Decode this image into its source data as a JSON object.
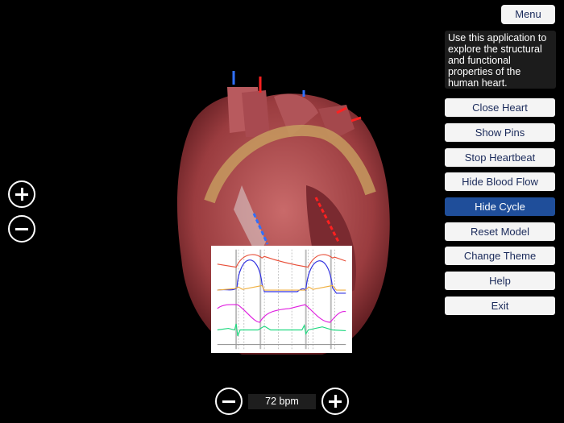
{
  "menu_label": "Menu",
  "info_text": "Use this application to explore the structural and functional properties of the human heart.",
  "buttons": [
    "Close Heart",
    "Show Pins",
    "Stop Heartbeat",
    "Hide Blood Flow",
    "Hide Cycle",
    "Reset Model",
    "Change Theme",
    "Help",
    "Exit"
  ],
  "active_button": "Hide Cycle",
  "heart_rate": "72 bpm",
  "colors": {
    "accent": "#1f4e9a",
    "button_text": "#1a2a5a"
  }
}
